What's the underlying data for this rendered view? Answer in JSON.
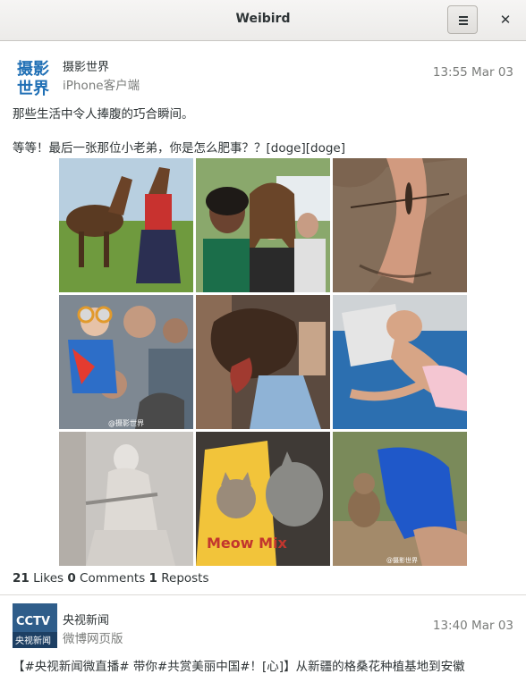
{
  "window": {
    "title": "Weibird",
    "menu_icon": "hamburger-icon",
    "close_label": "✕"
  },
  "posts": [
    {
      "author": "摄影世界",
      "avatar_text": [
        "摄影",
        "世界"
      ],
      "client": "iPhone客户端",
      "time": "13:55 Mar 03",
      "text_line1": "那些生活中令人捧腹的巧合瞬间。",
      "text_line2": "等等！最后一张那位小老弟，你是怎么肥事？？[doge][doge]",
      "images": [
        "horse-and-horse-headed-woman-photo",
        "smiling-women-photo",
        "dragonfly-on-leg-photo",
        "boy-with-goggles-crowd-photo",
        "horse-mask-photo",
        "sleeping-person-photo",
        "statue-photo",
        "cat-with-meow-mix-bag-photo",
        "monkey-and-blue-cloth-photo"
      ],
      "watermark": "@摄影世界",
      "bag_text": "Meow Mix",
      "stats": {
        "likes": "21",
        "likes_label": "Likes",
        "comments": "0",
        "comments_label": "Comments",
        "reposts": "1",
        "reposts_label": "Reposts"
      }
    },
    {
      "author": "央视新闻",
      "avatar_text": [
        "CCTV",
        "央视新闻"
      ],
      "client": "微博网页版",
      "time": "13:40 Mar 03",
      "text_line1": "【#央视新闻微直播# 带你#共赏美丽中国#！[心]】从新疆的格桑花种植基地到安徽"
    }
  ]
}
